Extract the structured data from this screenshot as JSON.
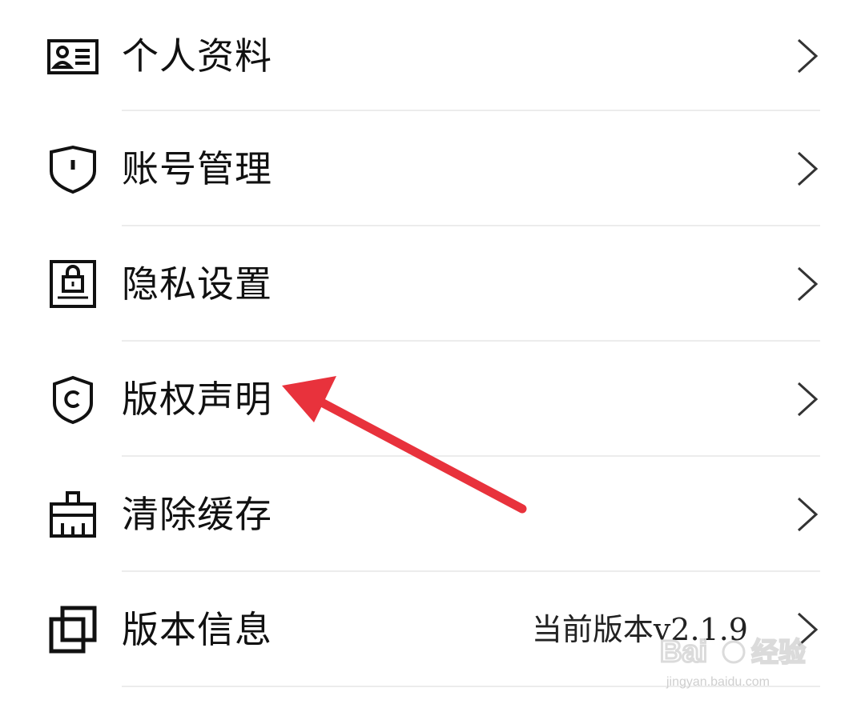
{
  "menu": {
    "items": [
      {
        "label": "个人资料",
        "icon": "profile-card-icon"
      },
      {
        "label": "账号管理",
        "icon": "shield-icon"
      },
      {
        "label": "隐私设置",
        "icon": "privacy-lock-icon"
      },
      {
        "label": "版权声明",
        "icon": "copyright-shield-icon"
      },
      {
        "label": "清除缓存",
        "icon": "broom-icon"
      },
      {
        "label": "版本信息",
        "icon": "overlap-squares-icon",
        "value": "当前版本v2.1.9"
      }
    ]
  },
  "annotation": {
    "arrow_color": "#e8323c",
    "points_to": "版权声明"
  },
  "watermark": {
    "brand": "Baidu经验",
    "url": "jingyan.baidu.com"
  }
}
